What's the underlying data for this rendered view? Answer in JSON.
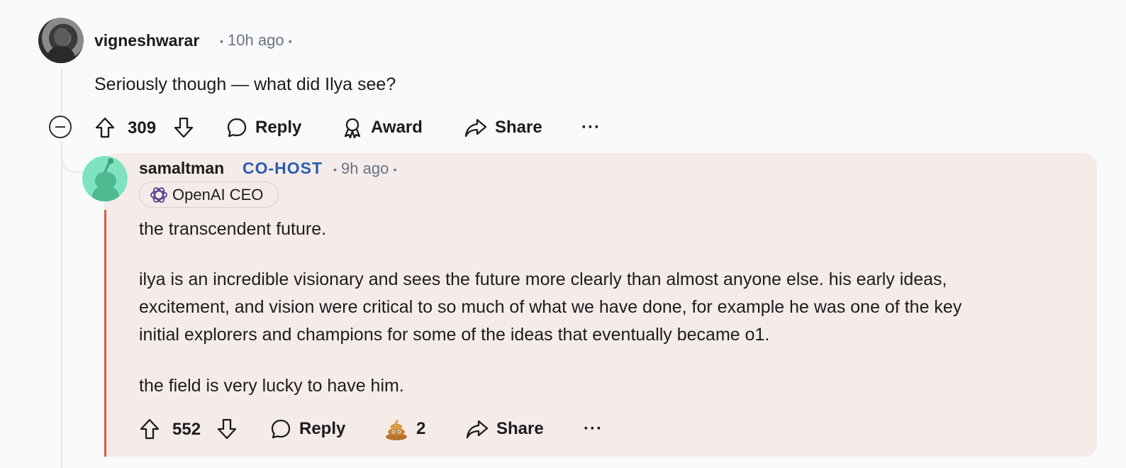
{
  "parent_comment": {
    "author": "vigneshwarar",
    "time": "10h ago",
    "separator": "•",
    "body": "Seriously though — what did Ilya see?",
    "score": "309",
    "actions": {
      "reply": "Reply",
      "award": "Award",
      "share": "Share",
      "more": "···"
    }
  },
  "reply_comment": {
    "author": "samaltman",
    "role_badge": "CO-HOST",
    "time": "9h ago",
    "separator": "•",
    "flair": "OpenAI CEO",
    "paragraphs": [
      "the transcendent future.",
      "ilya is an incredible visionary and sees the future more clearly than almost anyone else. his early ideas,",
      "excitement, and vision were critical to so much of what we have done, for example he was one of the key",
      "initial explorers and champions for some of the ideas that eventually became o1.",
      "the field is very lucky to have him."
    ],
    "score": "552",
    "award_count": "2",
    "actions": {
      "reply": "Reply",
      "share": "Share",
      "more": "···"
    }
  },
  "colors": {
    "cohost": "#2a5db0",
    "reply_card_bg": "#f5ecea",
    "reply_accent": "#d4603a"
  }
}
